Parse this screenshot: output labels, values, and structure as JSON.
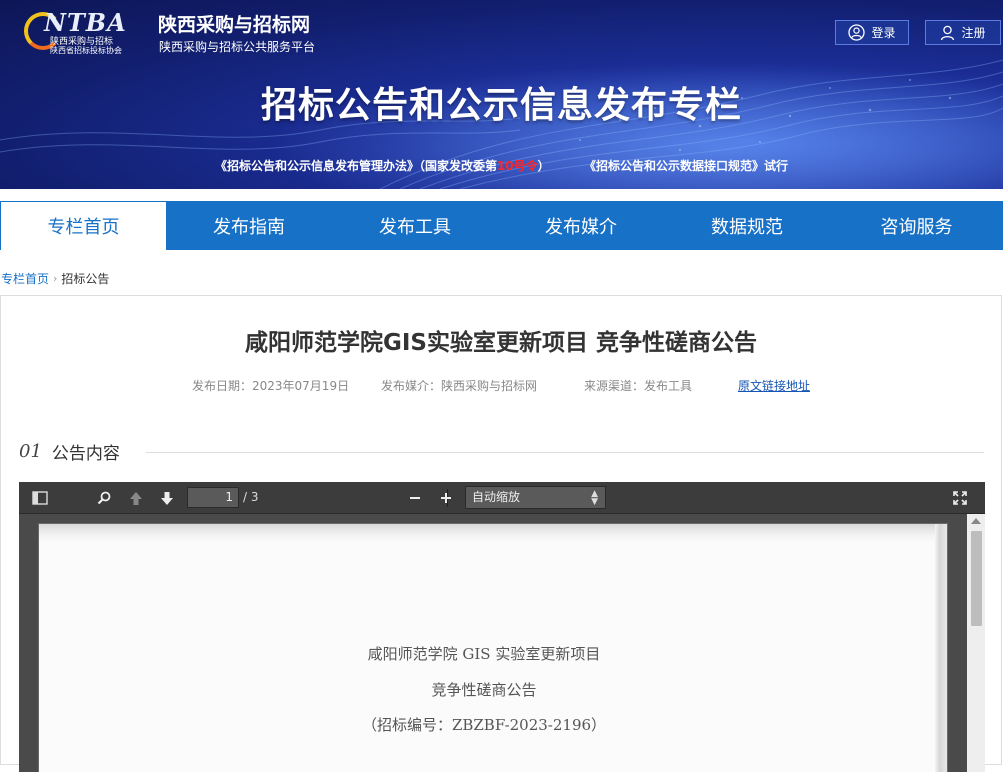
{
  "brand": {
    "logo_text": "NTBA",
    "logo_assoc_line1": "陕西采购与招标",
    "logo_assoc_line2": "陕西省招标投标协会",
    "site_name": "陕西采购与招标网",
    "site_subtitle": "陕西采购与招标公共服务平台"
  },
  "auth": {
    "login_label": "登录",
    "register_label": "注册"
  },
  "banner": {
    "title": "招标公告和公示信息发布专栏",
    "policy_part1": "《招标公告和公示信息发布管理办法》（国家发改委第",
    "policy_red": "10号令",
    "policy_part2": "）",
    "policy_part3": "《招标公告和公示数据接口规范》试行"
  },
  "nav": {
    "items": [
      "专栏首页",
      "发布指南",
      "发布工具",
      "发布媒介",
      "数据规范",
      "咨询服务"
    ],
    "active_index": 0
  },
  "breadcrumb": {
    "home": "专栏首页",
    "current": "招标公告"
  },
  "announcement": {
    "title": "咸阳师范学院GIS实验室更新项目 竞争性磋商公告",
    "date": "发布日期：2023年07月19日",
    "media": "发布媒介：陕西采购与招标网",
    "channel": "来源渠道：发布工具",
    "link_label": "原文链接地址"
  },
  "section": {
    "number": "01",
    "label": "公告内容"
  },
  "pdf_viewer": {
    "page_current": "1",
    "page_total": "/ 3",
    "zoom": "自动缩放",
    "doc_lines": [
      "咸阳师范学院 GIS 实验室更新项目",
      "竞争性磋商公告",
      "（招标编号：ZBZBF-2023-2196）"
    ]
  },
  "colors": {
    "nav_blue": "#1771c7",
    "link_blue": "#1556b5",
    "highlight_red": "#ff2525"
  }
}
